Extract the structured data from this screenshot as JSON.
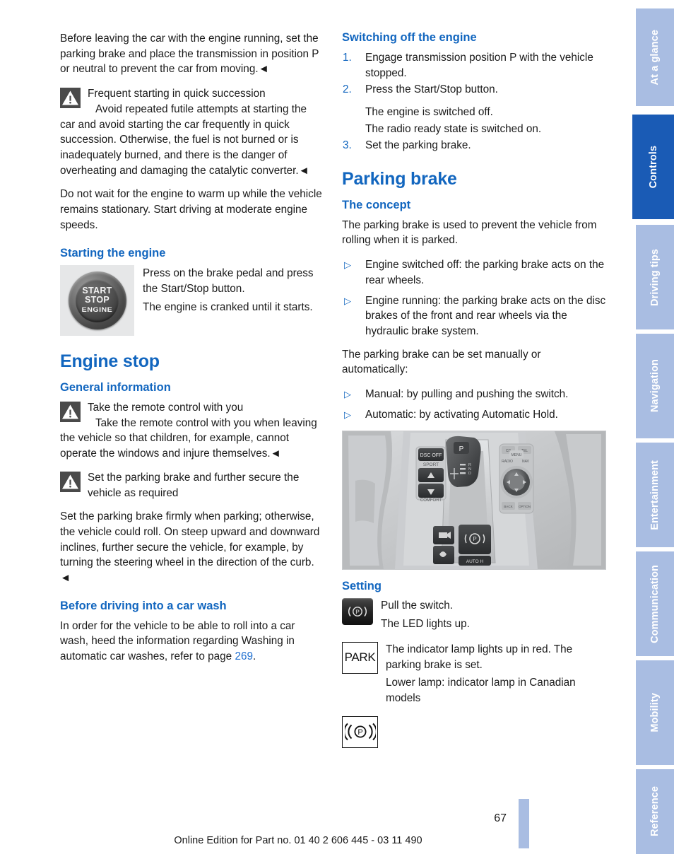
{
  "left_column": {
    "intro_paragraph": "Before leaving the car with the engine running, set the parking brake and place the transmission in position P or neutral to prevent the car from moving.◄",
    "warning_1": {
      "icon": "warning-triangle-icon",
      "title": "Frequent starting in quick succession",
      "body": "Avoid repeated futile attempts at starting the car and avoid starting the car frequently in quick succession. Otherwise, the fuel is not burned or is inadequately burned, and there is the danger of overheating and damaging the catalytic converter.◄"
    },
    "warmup_paragraph": "Do not wait for the engine to warm up while the vehicle remains stationary. Start driving at moderate engine speeds.",
    "starting_heading": "Starting the engine",
    "start_button": {
      "line1": "START",
      "line2": "STOP",
      "line3": "ENGINE"
    },
    "starting_text_1": "Press on the brake pedal and press the Start/Stop button.",
    "starting_text_2": "The engine is cranked until it starts.",
    "engine_stop_heading": "Engine stop",
    "general_info_heading": "General information",
    "warning_2": {
      "icon": "warning-triangle-icon",
      "title": "Take the remote control with you",
      "body": "Take the remote control with you when leaving the vehicle so that children, for example, cannot operate the windows and injure themselves.◄"
    },
    "warning_3": {
      "icon": "warning-triangle-icon",
      "title": "Set the parking brake and further secure the vehicle as required"
    },
    "parking_paragraph": "Set the parking brake firmly when parking; otherwise, the vehicle could roll. On steep upward and downward inclines, further secure the vehicle, for example, by turning the steering wheel in the direction of the curb. ◄",
    "car_wash_heading": "Before driving into a car wash",
    "car_wash_text_before": "In order for the vehicle to be able to roll into a car wash, heed the information regarding Washing in automatic car washes, refer to page ",
    "car_wash_page_ref": "269",
    "car_wash_text_after": "."
  },
  "right_column": {
    "switching_off_heading": "Switching off the engine",
    "steps": [
      {
        "num": "1.",
        "text": "Engage transmission position P with the vehicle stopped."
      },
      {
        "num": "2.",
        "text": "Press the Start/Stop button."
      },
      {
        "num": "3.",
        "text": "Set the parking brake."
      }
    ],
    "step2_results": [
      "The engine is switched off.",
      "The radio ready state is switched on."
    ],
    "parking_brake_heading": "Parking brake",
    "concept_heading": "The concept",
    "concept_intro": "The parking brake is used to prevent the vehicle from rolling when it is parked.",
    "concept_bullets": [
      "Engine switched off: the parking brake acts on the rear wheels.",
      "Engine running: the parking brake acts on the disc brakes of the front and rear wheels via the hydraulic brake system."
    ],
    "manual_auto_intro": "The parking brake can be set manually or automatically:",
    "manual_auto_bullets": [
      "Manual: by pulling and pushing the switch.",
      "Automatic: by activating Automatic Hold."
    ],
    "console_figure": {
      "alt": "center-console-photo",
      "labels": [
        "DSC OFF",
        "SPORT",
        "COMFORT",
        "P",
        "CD",
        "MENU",
        "TEL",
        "RADIO",
        "NAV",
        "BACK",
        "OPTION",
        "AUTO H"
      ]
    },
    "setting_heading": "Setting",
    "setting_rows": [
      {
        "icon": "parking-brake-switch-icon",
        "icon_label": "((P))",
        "lines": [
          "Pull the switch.",
          "The LED lights up."
        ]
      },
      {
        "icon": "park-indicator-lamp-icon",
        "icon_label": "PARK",
        "lines": [
          "The indicator lamp lights up in red. The parking brake is set."
        ]
      },
      {
        "icon": "canadian-parking-brake-lamp-icon",
        "icon_label": "((P))",
        "lines": [
          "Lower lamp: indicator lamp in Canadian models"
        ]
      }
    ]
  },
  "sidebar": {
    "tabs": [
      {
        "label": "At a glance",
        "active": false
      },
      {
        "label": "Controls",
        "active": true
      },
      {
        "label": "Driving tips",
        "active": false
      },
      {
        "label": "Navigation",
        "active": false
      },
      {
        "label": "Entertainment",
        "active": false
      },
      {
        "label": "Communication",
        "active": false
      },
      {
        "label": "Mobility",
        "active": false
      },
      {
        "label": "Reference",
        "active": false
      }
    ]
  },
  "footer": {
    "page_number": "67",
    "edition_text": "Online Edition for Part no. 01 40 2 606 445 - 03 11 490"
  },
  "colors": {
    "heading_blue": "#1266bf",
    "tab_active": "#1a5bb5",
    "tab_inactive": "#a9bde2",
    "link_blue": "#1f6fd0",
    "warning_icon_bg": "#4a4a4a"
  }
}
